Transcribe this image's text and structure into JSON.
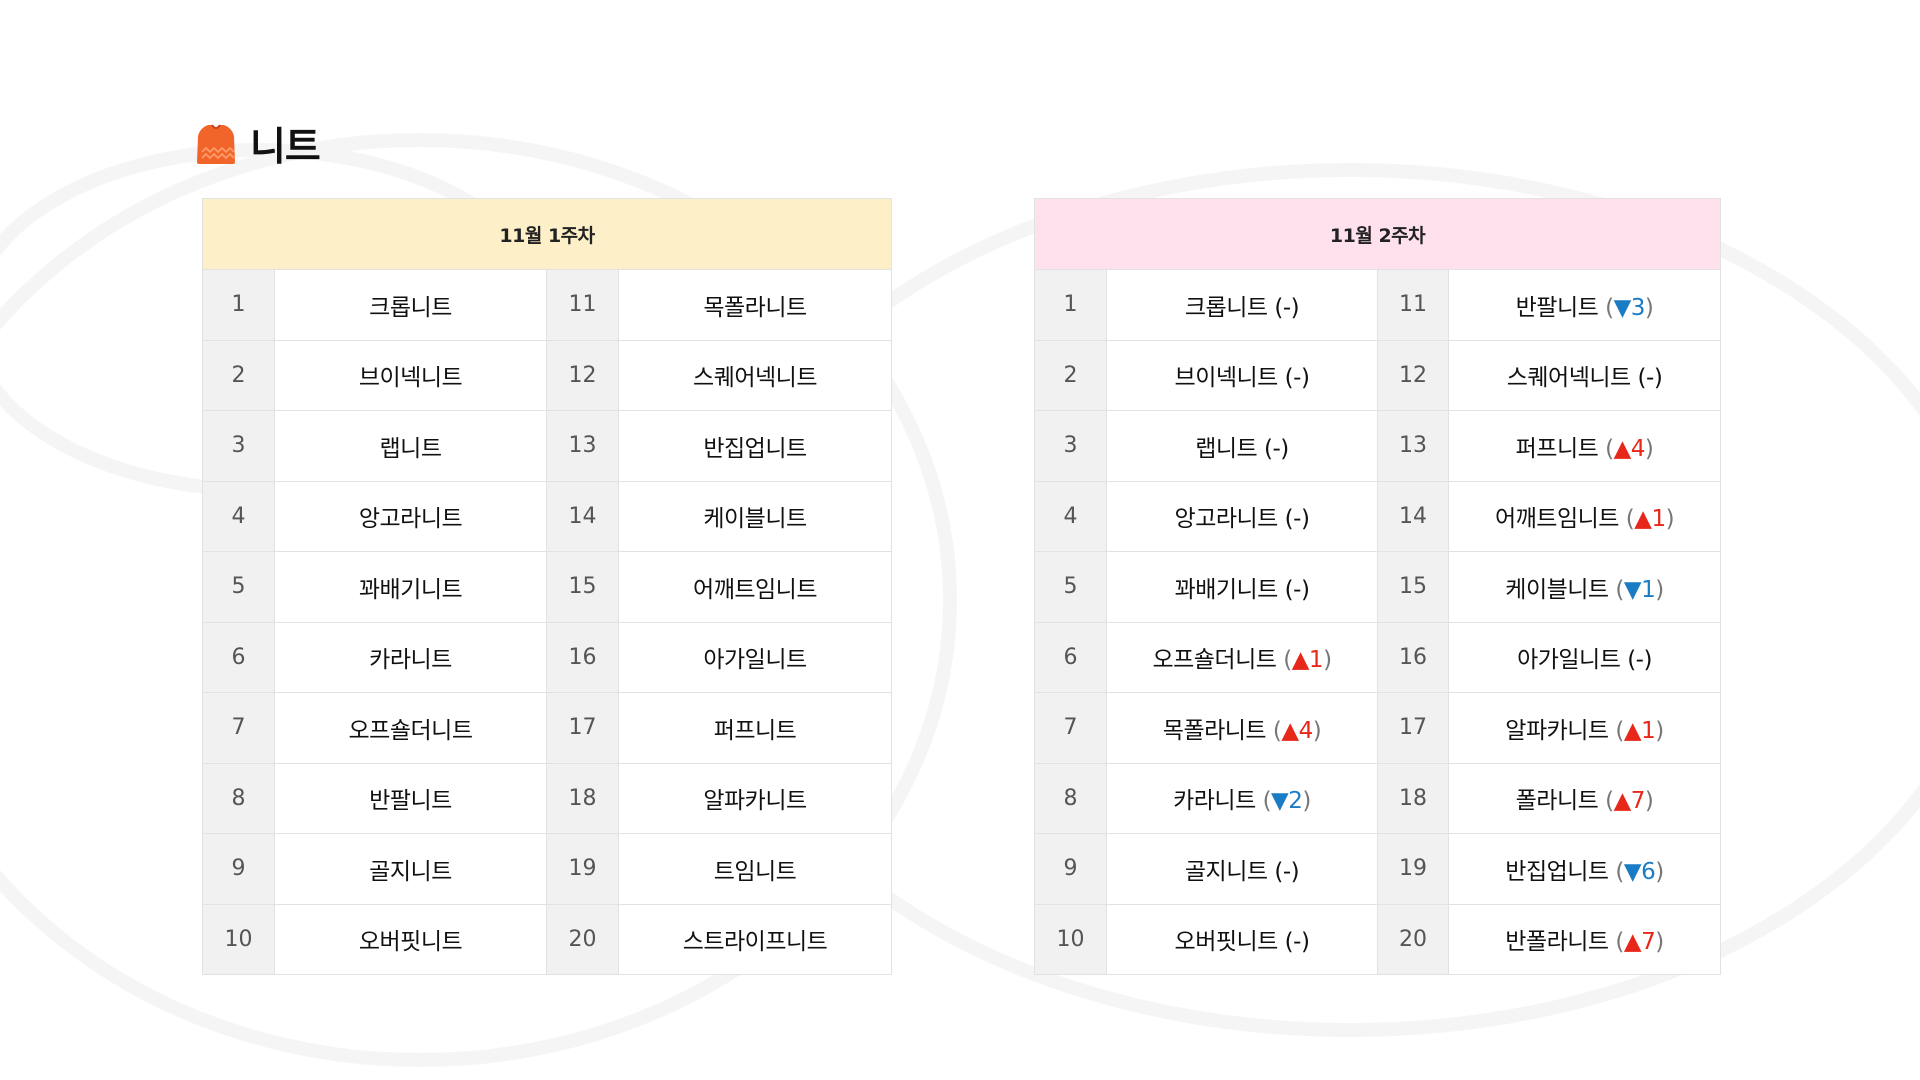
{
  "page": {
    "title": "니트",
    "icon": "knit-sweater-icon",
    "accent_color": "#f2652a"
  },
  "colors": {
    "week1_header_bg": "#fdf0c8",
    "week2_header_bg": "#ffe1ee",
    "rank_cell_bg": "#f1f1f1",
    "rise_color": "#e8271b",
    "fall_color": "#1a7cc4"
  },
  "week1": {
    "header": "11월 1주차",
    "rows": [
      {
        "rank_left": "1",
        "item_left": "크롭니트",
        "rank_right": "11",
        "item_right": "목폴라니트"
      },
      {
        "rank_left": "2",
        "item_left": "브이넥니트",
        "rank_right": "12",
        "item_right": "스퀘어넥니트"
      },
      {
        "rank_left": "3",
        "item_left": "랩니트",
        "rank_right": "13",
        "item_right": "반집업니트"
      },
      {
        "rank_left": "4",
        "item_left": "앙고라니트",
        "rank_right": "14",
        "item_right": "케이블니트"
      },
      {
        "rank_left": "5",
        "item_left": "꽈배기니트",
        "rank_right": "15",
        "item_right": "어깨트임니트"
      },
      {
        "rank_left": "6",
        "item_left": "카라니트",
        "rank_right": "16",
        "item_right": "아가일니트"
      },
      {
        "rank_left": "7",
        "item_left": "오프숄더니트",
        "rank_right": "17",
        "item_right": "퍼프니트"
      },
      {
        "rank_left": "8",
        "item_left": "반팔니트",
        "rank_right": "18",
        "item_right": "알파카니트"
      },
      {
        "rank_left": "9",
        "item_left": "골지니트",
        "rank_right": "19",
        "item_right": "트임니트"
      },
      {
        "rank_left": "10",
        "item_left": "오버핏니트",
        "rank_right": "20",
        "item_right": "스트라이프니트"
      }
    ]
  },
  "week2": {
    "header": "11월 2주차",
    "rows": [
      {
        "rank_left": "1",
        "item_left": "크롭니트",
        "change_left": {
          "dir": "flat",
          "symbol": "-",
          "value": ""
        },
        "rank_right": "11",
        "item_right": "반팔니트",
        "change_right": {
          "dir": "down",
          "symbol": "▼",
          "value": "3"
        }
      },
      {
        "rank_left": "2",
        "item_left": "브이넥니트",
        "change_left": {
          "dir": "flat",
          "symbol": "-",
          "value": ""
        },
        "rank_right": "12",
        "item_right": "스퀘어넥니트",
        "change_right": {
          "dir": "flat",
          "symbol": "-",
          "value": ""
        }
      },
      {
        "rank_left": "3",
        "item_left": "랩니트",
        "change_left": {
          "dir": "flat",
          "symbol": "-",
          "value": ""
        },
        "rank_right": "13",
        "item_right": "퍼프니트",
        "change_right": {
          "dir": "up",
          "symbol": "▲",
          "value": "4"
        }
      },
      {
        "rank_left": "4",
        "item_left": "앙고라니트",
        "change_left": {
          "dir": "flat",
          "symbol": "-",
          "value": ""
        },
        "rank_right": "14",
        "item_right": "어깨트임니트",
        "change_right": {
          "dir": "up",
          "symbol": "▲",
          "value": "1"
        }
      },
      {
        "rank_left": "5",
        "item_left": "꽈배기니트",
        "change_left": {
          "dir": "flat",
          "symbol": "-",
          "value": ""
        },
        "rank_right": "15",
        "item_right": "케이블니트",
        "change_right": {
          "dir": "down",
          "symbol": "▼",
          "value": "1"
        }
      },
      {
        "rank_left": "6",
        "item_left": "오프숄더니트",
        "change_left": {
          "dir": "up",
          "symbol": "▲",
          "value": "1"
        },
        "rank_right": "16",
        "item_right": "아가일니트",
        "change_right": {
          "dir": "flat",
          "symbol": "-",
          "value": ""
        }
      },
      {
        "rank_left": "7",
        "item_left": "목폴라니트",
        "change_left": {
          "dir": "up",
          "symbol": "▲",
          "value": "4"
        },
        "rank_right": "17",
        "item_right": "알파카니트",
        "change_right": {
          "dir": "up",
          "symbol": "▲",
          "value": "1"
        }
      },
      {
        "rank_left": "8",
        "item_left": "카라니트",
        "change_left": {
          "dir": "down",
          "symbol": "▼",
          "value": "2"
        },
        "rank_right": "18",
        "item_right": "폴라니트",
        "change_right": {
          "dir": "up",
          "symbol": "▲",
          "value": "7"
        }
      },
      {
        "rank_left": "9",
        "item_left": "골지니트",
        "change_left": {
          "dir": "flat",
          "symbol": "-",
          "value": ""
        },
        "rank_right": "19",
        "item_right": "반집업니트",
        "change_right": {
          "dir": "down",
          "symbol": "▼",
          "value": "6"
        }
      },
      {
        "rank_left": "10",
        "item_left": "오버핏니트",
        "change_left": {
          "dir": "flat",
          "symbol": "-",
          "value": ""
        },
        "rank_right": "20",
        "item_right": "반폴라니트",
        "change_right": {
          "dir": "up",
          "symbol": "▲",
          "value": "7"
        }
      }
    ]
  }
}
